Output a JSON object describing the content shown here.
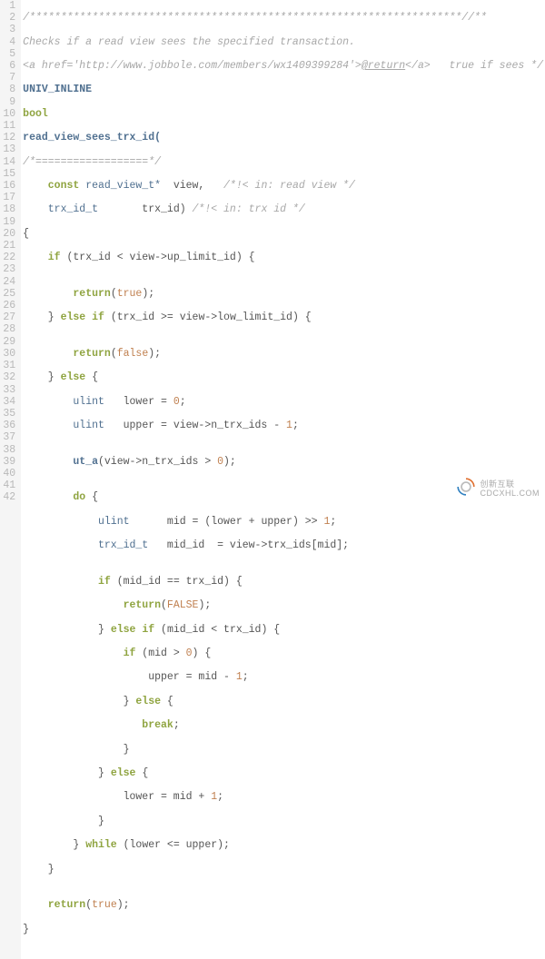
{
  "gutter": [
    "1",
    "2",
    "3",
    "4",
    "5",
    "6",
    "7",
    "8",
    "9",
    "10",
    "11",
    "12",
    "13",
    "14",
    "15",
    "16",
    "17",
    "18",
    "19",
    "20",
    "21",
    "22",
    "23",
    "24",
    "25",
    "26",
    "27",
    "28",
    "29",
    "30",
    "31",
    "32",
    "33",
    "34",
    "35",
    "36",
    "37",
    "38",
    "39",
    "40",
    "41",
    "42"
  ],
  "code": {
    "l1": "/*********************************************************************//**",
    "l2": "Checks if a read view sees the specified transaction.",
    "l3a": "<a href='http://www.jobbole.com/members/wx1409399284'>",
    "l3b": "@return",
    "l3c": "</a>",
    "l3d": "   true if sees */",
    "l4": "UNIV_INLINE",
    "l5": "bool",
    "l6": "read_view_sees_trx_id(",
    "l7": "/*==================*/",
    "l8_kw": "const",
    "l8_type": " read_view_t*",
    "l8_var": "  view,",
    "l8_cmt": "   /*!< in: read view */",
    "l9_type": "trx_id_t",
    "l9_var": "       trx_id)",
    "l9_cmt": " /*!< in: trx id */",
    "l10": "{",
    "l11_kw": "if",
    "l11_txt": " (trx_id < view->up_limit_id) {",
    "l12": "",
    "l13_kw": "return",
    "l13_txt": "(",
    "l13_val": "true",
    "l13_end": ");",
    "l14_txt": "} ",
    "l14_kw1": "else",
    "l14_kw2": " if",
    "l14_rest": " (trx_id >= view->low_limit_id) {",
    "l15": "",
    "l16_kw": "return",
    "l16_txt": "(",
    "l16_val": "false",
    "l16_end": ");",
    "l17_txt": "} ",
    "l17_kw": "else",
    "l17_rest": " {",
    "l18_type": "ulint",
    "l18_var": "   lower = ",
    "l18_num": "0",
    "l18_end": ";",
    "l19_type": "ulint",
    "l19_var": "   upper = view->n_trx_ids - ",
    "l19_num": "1",
    "l19_end": ";",
    "l20": "",
    "l21_fn": "ut_a",
    "l21_txt": "(view->n_trx_ids > ",
    "l21_num": "0",
    "l21_end": ");",
    "l22": "",
    "l23_kw": "do",
    "l23_txt": " {",
    "l24_type": "ulint",
    "l24_txt": "      mid = (lower + upper) >> ",
    "l24_num": "1",
    "l24_end": ";",
    "l25_type": "trx_id_t",
    "l25_txt": "   mid_id  = view->trx_ids[mid];",
    "l26": "",
    "l27_kw": "if",
    "l27_txt": " (mid_id == trx_id) {",
    "l28_kw": "return",
    "l28_txt": "(",
    "l28_val": "FALSE",
    "l28_end": ");",
    "l29_txt": "} ",
    "l29_kw1": "else",
    "l29_kw2": " if",
    "l29_rest": " (mid_id < trx_id) {",
    "l30_kw": "if",
    "l30_txt": " (mid > ",
    "l30_num": "0",
    "l30_end": ") {",
    "l31_txt": "upper = mid - ",
    "l31_num": "1",
    "l31_end": ";",
    "l32_txt": "} ",
    "l32_kw": "else",
    "l32_rest": " {",
    "l33_kw": "break",
    "l33_end": ";",
    "l34": "}",
    "l35_txt": "} ",
    "l35_kw": "else",
    "l35_rest": " {",
    "l36_txt": "lower = mid + ",
    "l36_num": "1",
    "l36_end": ";",
    "l37": "}",
    "l38_txt": "} ",
    "l38_kw": "while",
    "l38_rest": " (lower <= upper);",
    "l39": "}",
    "l40": "",
    "l41_kw": "return",
    "l41_txt": "(",
    "l41_val": "true",
    "l41_end": ");",
    "l42": "}"
  },
  "watermark": {
    "line1": "创新互联",
    "line2": "CDCXHL.COM"
  }
}
